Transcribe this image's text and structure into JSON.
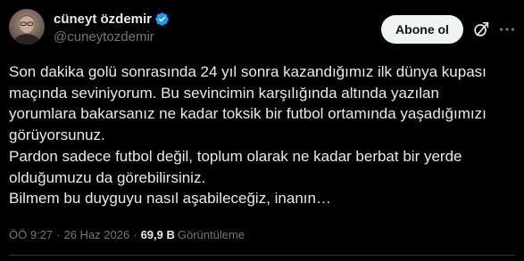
{
  "author": {
    "display_name": "cüneyt özdemir",
    "handle": "@cuneytozdemir",
    "verified": true
  },
  "actions": {
    "follow_label": "Abone ol"
  },
  "icons": {
    "verified": "verified-badge-icon",
    "grok": "grok-icon",
    "more": "more-options-icon"
  },
  "post": {
    "lines": [
      "Son dakika golü sonrasında 24 yıl sonra kazandığımız ilk dünya kupası",
      "maçında seviniyorum. Bu sevincimin karşılığında altında yazılan",
      "yorumlara bakarsanız ne kadar toksik bir futbol ortamında yaşadığımızı",
      "görüyorsunuz.",
      "Pardon sadece futbol değil, toplum olarak ne kadar berbat bir yerde",
      "olduğumuzu da görebilirsiniz.",
      "Bilmem bu duyguyu nasıl aşabileceğiz, inanın…"
    ]
  },
  "meta": {
    "time": "ÖÖ 9:27",
    "separator": "·",
    "date": "26 Haz 2026",
    "views_count": "69,9 B",
    "views_label": "Görüntüleme"
  },
  "colors": {
    "background": "#000000",
    "text": "#e7e9ea",
    "muted": "#71767b",
    "verified": "#1d9bf0",
    "button_bg": "#eff3f4",
    "button_text": "#0f1419"
  }
}
